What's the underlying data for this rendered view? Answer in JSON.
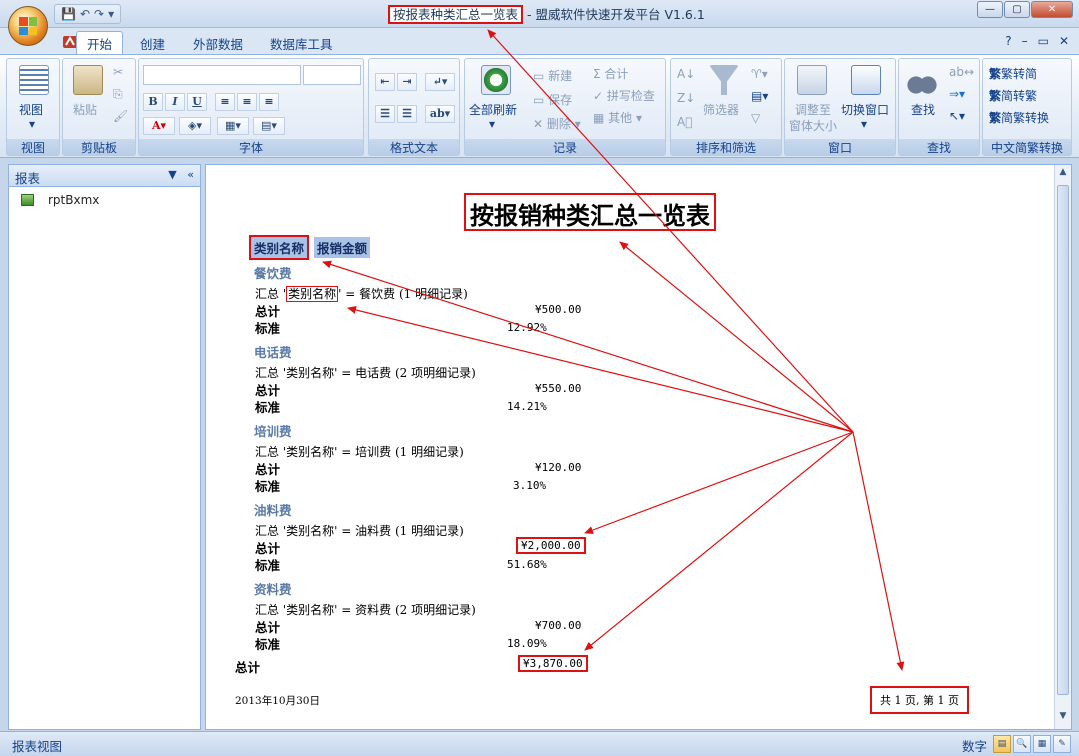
{
  "window": {
    "title_highlight": "按报表种类汇总一览表",
    "title_rest": " - 盟威软件快速开发平台 V1.6.1",
    "controls": {
      "minimize": "—",
      "maximize": "▢",
      "close": "✕"
    }
  },
  "quick_access": {
    "save": "💾",
    "undo": "↶",
    "redo": "↷",
    "more": "▾"
  },
  "tabs": [
    {
      "label": "开始",
      "active": true
    },
    {
      "label": "创建"
    },
    {
      "label": "外部数据"
    },
    {
      "label": "数据库工具"
    }
  ],
  "help": {
    "help": "?",
    "min": "–",
    "restore": "▭",
    "close": "✕"
  },
  "ribbon": {
    "view_group": {
      "label": "视图",
      "button": "视图"
    },
    "clipboard_group": {
      "label": "剪贴板",
      "paste": "粘贴"
    },
    "font_group": {
      "label": "字体",
      "bold": "B",
      "italic": "I",
      "underline": "U"
    },
    "rich_text_group": {
      "label": "格式文本"
    },
    "records_group": {
      "label": "记录",
      "refresh_all": "全部刷新",
      "new": "新建",
      "save": "保存",
      "delete": "删除",
      "totals": "合计",
      "spelling": "拼写检查",
      "other": "其他"
    },
    "sort_group": {
      "label": "排序和筛选",
      "filter": "筛选器"
    },
    "window_group": {
      "label": "窗口",
      "fit": "调整至",
      "fit2": "窗体大小",
      "switch": "切换窗口"
    },
    "find_group": {
      "label": "查找",
      "find": "查找"
    },
    "chinese_group": {
      "label": "中文简繁转换",
      "t2s": "繁转简",
      "s2t": "简转繁",
      "convert": "简繁转换"
    }
  },
  "nav": {
    "header": "报表",
    "items": [
      {
        "label": "rptBxmx"
      }
    ]
  },
  "report": {
    "title": "按报销种类汇总一览表",
    "col_category": "类别名称",
    "col_amount": "报销金额",
    "total_label": "总计",
    "standard_label": "标准",
    "groups": [
      {
        "category": "餐饮费",
        "summary_prefix": "汇总 '",
        "summary_field": "类别名称",
        "summary_suffix": "' =  餐饮费 (1 明细记录)",
        "total": "¥500.00",
        "standard": "12.92%"
      },
      {
        "category": "电话费",
        "summary_prefix": "汇总 '",
        "summary_field": "类别名称",
        "summary_suffix": "' =  电话费 (2 项明细记录)",
        "total": "¥550.00",
        "standard": "14.21%"
      },
      {
        "category": "培训费",
        "summary_prefix": "汇总 '",
        "summary_field": "类别名称",
        "summary_suffix": "' =  培训费 (1 明细记录)",
        "total": "¥120.00",
        "standard": "3.10%"
      },
      {
        "category": "油料费",
        "summary_prefix": "汇总 '",
        "summary_field": "类别名称",
        "summary_suffix": "' =  油料费 (1 明细记录)",
        "total": "¥2,000.00",
        "standard": "51.68%"
      },
      {
        "category": "资料费",
        "summary_prefix": "汇总 '",
        "summary_field": "类别名称",
        "summary_suffix": "' =  资料费 (2 项明细记录)",
        "total": "¥700.00",
        "standard": "18.09%"
      }
    ],
    "grand_total_label": "总计",
    "grand_total": "¥3,870.00",
    "date": "2013年10月30日",
    "page_info": "共 1 页, 第 1 页"
  },
  "status": {
    "left": "报表视图",
    "right": "数字"
  },
  "colors": {
    "annotation": "#dd1111",
    "ribbon_text": "#15428b",
    "col_header_bg": "#a8c3e6"
  }
}
